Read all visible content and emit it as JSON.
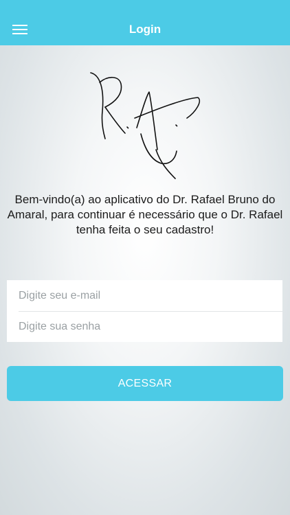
{
  "header": {
    "title": "Login",
    "menu_icon": "hamburger-menu-icon",
    "bg_color": "#4ccbe6"
  },
  "logo": {
    "text": "R.A."
  },
  "welcome": {
    "text": "Bem-vindo(a) ao aplicativo do Dr. Rafael Bruno do Amaral, para continuar é necessário que o Dr. Rafael tenha feita o seu cadastro!"
  },
  "form": {
    "email_placeholder": "Digite seu e-mail",
    "email_value": "",
    "password_placeholder": "Digite sua senha",
    "password_value": ""
  },
  "actions": {
    "access_label": "ACESSAR",
    "accent_color": "#4ccbe6"
  }
}
